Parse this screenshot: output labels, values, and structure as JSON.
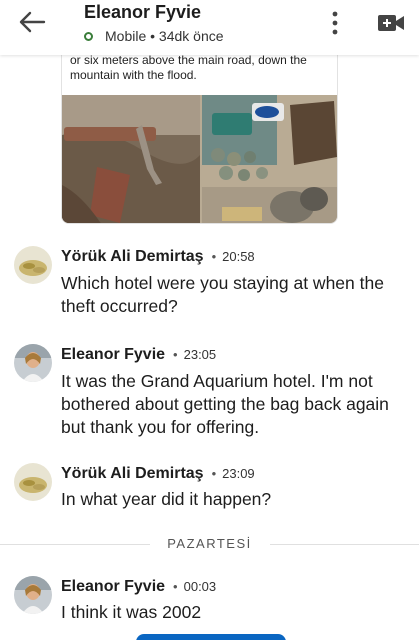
{
  "header": {
    "contact_name": "Eleanor Fyvie",
    "status": "Mobile • 34dk önce"
  },
  "shared_post": {
    "caption": "or six meters above the main road, down the mountain with the flood."
  },
  "messages": [
    {
      "sender": "Yörük Ali Demirtaş",
      "time": "20:58",
      "text": "Which hotel were you staying at when the theft occurred?"
    },
    {
      "sender": "Eleanor Fyvie",
      "time": "23:05",
      "text": "It was the Grand Aquarium hotel.  I'm not bothered about getting the bag back again but thank you for offering."
    },
    {
      "sender": "Yörük Ali Demirtaş",
      "time": "23:09",
      "text": "In what year did it happen?"
    },
    {
      "sender": "Eleanor Fyvie",
      "time": "00:03",
      "text": "I think it was 2002"
    }
  ],
  "day_divider": "PAZARTESİ",
  "separator": "•",
  "colors": {
    "accent": "#0a66c2",
    "online_ring": "#3a7d3a"
  }
}
